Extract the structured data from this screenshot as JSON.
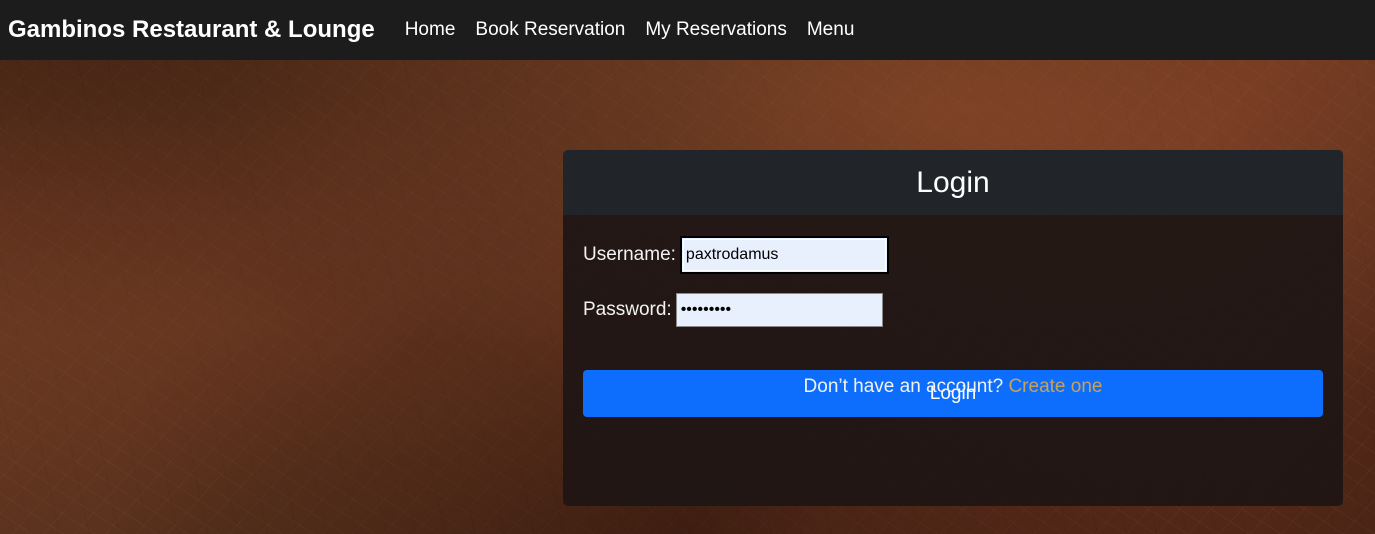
{
  "navbar": {
    "brand": "Gambinos Restaurant & Lounge",
    "links": [
      "Home",
      "Book Reservation",
      "My Reservations",
      "Menu"
    ]
  },
  "login_card": {
    "title": "Login",
    "username_label": "Username:",
    "username_value": "paxtrodamus",
    "password_label": "Password:",
    "password_value": "•••••••••",
    "submit_label": "Login",
    "signup_prompt": "Don’t have an account?",
    "signup_link": "Create one"
  },
  "colors": {
    "navbar_bg": "#1c1c1c",
    "primary_button": "#0d6efd",
    "link_accent": "#c9a15a",
    "card_header": "#212529"
  }
}
